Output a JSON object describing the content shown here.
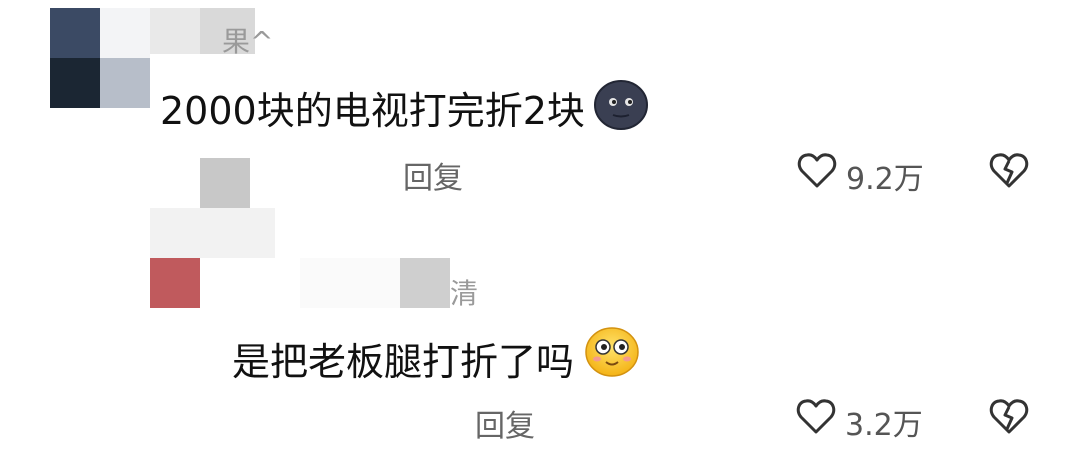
{
  "comments": [
    {
      "username_fragment": "果^",
      "text": "2000块的电视打完折2块",
      "emoji": "new-moon-face-icon",
      "reply_label": "回复",
      "like_count": "9.2万"
    },
    {
      "username_fragment": "清",
      "text": "是把老板腿打折了吗",
      "emoji": "smiling-face-icon",
      "reply_label": "回复",
      "like_count": "3.2万"
    }
  ],
  "colors": {
    "text": "#111111",
    "secondary": "#666666"
  }
}
